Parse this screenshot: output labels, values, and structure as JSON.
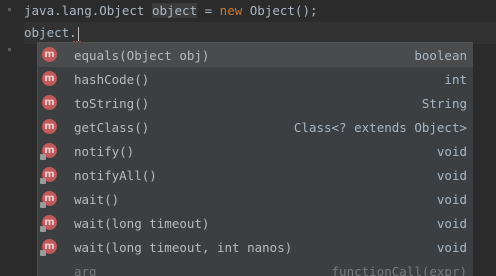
{
  "editor": {
    "line1": {
      "part1": "java.lang.Object ",
      "part2": "object",
      "part3": " = ",
      "part4": "new",
      "part5": " Object();"
    },
    "line2": {
      "text": "object."
    }
  },
  "completion": {
    "items": [
      {
        "icon": "method-icon",
        "label": "equals(Object obj)",
        "type": "boolean",
        "locked": false
      },
      {
        "icon": "method-icon",
        "label": "hashCode()",
        "type": "int",
        "locked": false
      },
      {
        "icon": "method-icon",
        "label": "toString()",
        "type": "String",
        "locked": false
      },
      {
        "icon": "method-icon",
        "label": "getClass()",
        "type": "Class<? extends Object>",
        "locked": false
      },
      {
        "icon": "method-icon",
        "label": "notify()",
        "type": "void",
        "locked": true
      },
      {
        "icon": "method-icon",
        "label": "notifyAll()",
        "type": "void",
        "locked": true
      },
      {
        "icon": "method-icon",
        "label": "wait()",
        "type": "void",
        "locked": true
      },
      {
        "icon": "method-icon",
        "label": "wait(long timeout)",
        "type": "void",
        "locked": true
      },
      {
        "icon": "method-icon",
        "label": "wait(long timeout, int nanos)",
        "type": "void",
        "locked": true
      },
      {
        "icon": "",
        "label": "arg",
        "type": "functionCall(expr)",
        "locked": false
      }
    ]
  },
  "colors": {
    "background": "#2b2b2b",
    "popup": "#3c3f41",
    "selected": "#4b4d4f",
    "keyword": "#cc7832",
    "method_icon": "#c35959"
  }
}
